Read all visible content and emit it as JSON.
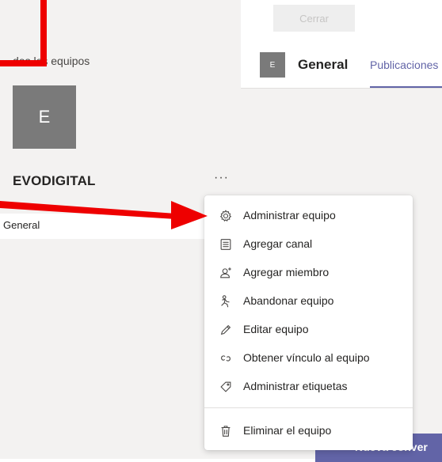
{
  "top": {
    "close_label": "Cerrar"
  },
  "left_panel": {
    "all_teams_label": "dos los equipos",
    "team_avatar_letter": "E",
    "team_name": "EVODIGITAL",
    "more_label": "···",
    "channel_label": "General"
  },
  "channel_header": {
    "avatar_letter": "E",
    "title": "General",
    "tab_label": "Publicaciones"
  },
  "new_conversation_label": "Nueva conver",
  "menu": {
    "items": [
      {
        "label": "Administrar equipo",
        "icon": "gear-icon"
      },
      {
        "label": "Agregar canal",
        "icon": "channel-icon"
      },
      {
        "label": "Agregar miembro",
        "icon": "add-member-icon"
      },
      {
        "label": "Abandonar equipo",
        "icon": "leave-icon"
      },
      {
        "label": "Editar equipo",
        "icon": "pencil-icon"
      },
      {
        "label": "Obtener vínculo al equipo",
        "icon": "link-icon"
      },
      {
        "label": "Administrar etiquetas",
        "icon": "tag-icon"
      },
      {
        "label": "Eliminar el equipo",
        "icon": "trash-icon"
      }
    ]
  },
  "colors": {
    "accent": "#6264a7",
    "annotation": "#ee0000",
    "panel_bg": "#f3f2f1",
    "avatar_bg": "#7a7a7a"
  }
}
